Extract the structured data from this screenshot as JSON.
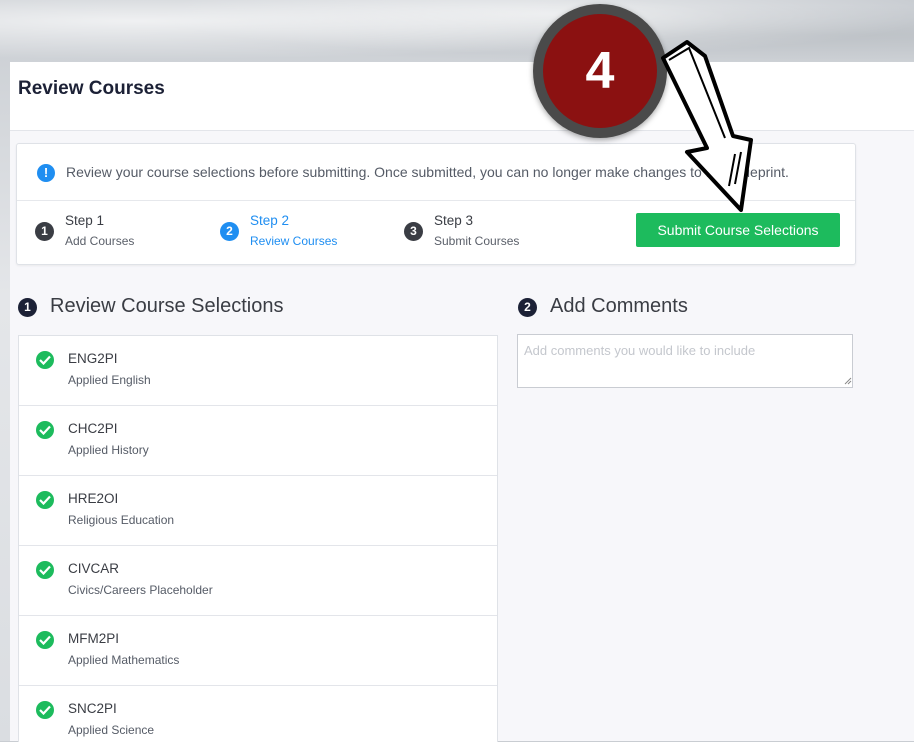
{
  "header": {
    "title": "Review Courses"
  },
  "notice": {
    "icon": "info-icon",
    "text": "Review your course selections before submitting. Once submitted, you can no longer make changes to this blueprint."
  },
  "steps": [
    {
      "num": "1",
      "title": "Step 1",
      "sub": "Add Courses",
      "state": "done"
    },
    {
      "num": "2",
      "title": "Step 2",
      "sub": "Review Courses",
      "state": "active"
    },
    {
      "num": "3",
      "title": "Step 3",
      "sub": "Submit Courses",
      "state": "upcoming"
    }
  ],
  "submit_label": "Submit Course Selections",
  "sections": {
    "review": {
      "num": "1",
      "title": "Review Course Selections"
    },
    "comments": {
      "num": "2",
      "title": "Add Comments",
      "placeholder": "Add comments you would like to include"
    }
  },
  "courses": [
    {
      "code": "ENG2PI",
      "name": "Applied English"
    },
    {
      "code": "CHC2PI",
      "name": "Applied History"
    },
    {
      "code": "HRE2OI",
      "name": "Religious Education"
    },
    {
      "code": "CIVCAR",
      "name": "Civics/Careers Placeholder"
    },
    {
      "code": "MFM2PI",
      "name": "Applied Mathematics"
    },
    {
      "code": "SNC2PI",
      "name": "Applied Science"
    }
  ],
  "annotation": {
    "badge_number": "4"
  },
  "colors": {
    "accent": "#1f8ef1",
    "success": "#1dbb5d",
    "badge": "#8b1111",
    "title": "#1c2136"
  }
}
